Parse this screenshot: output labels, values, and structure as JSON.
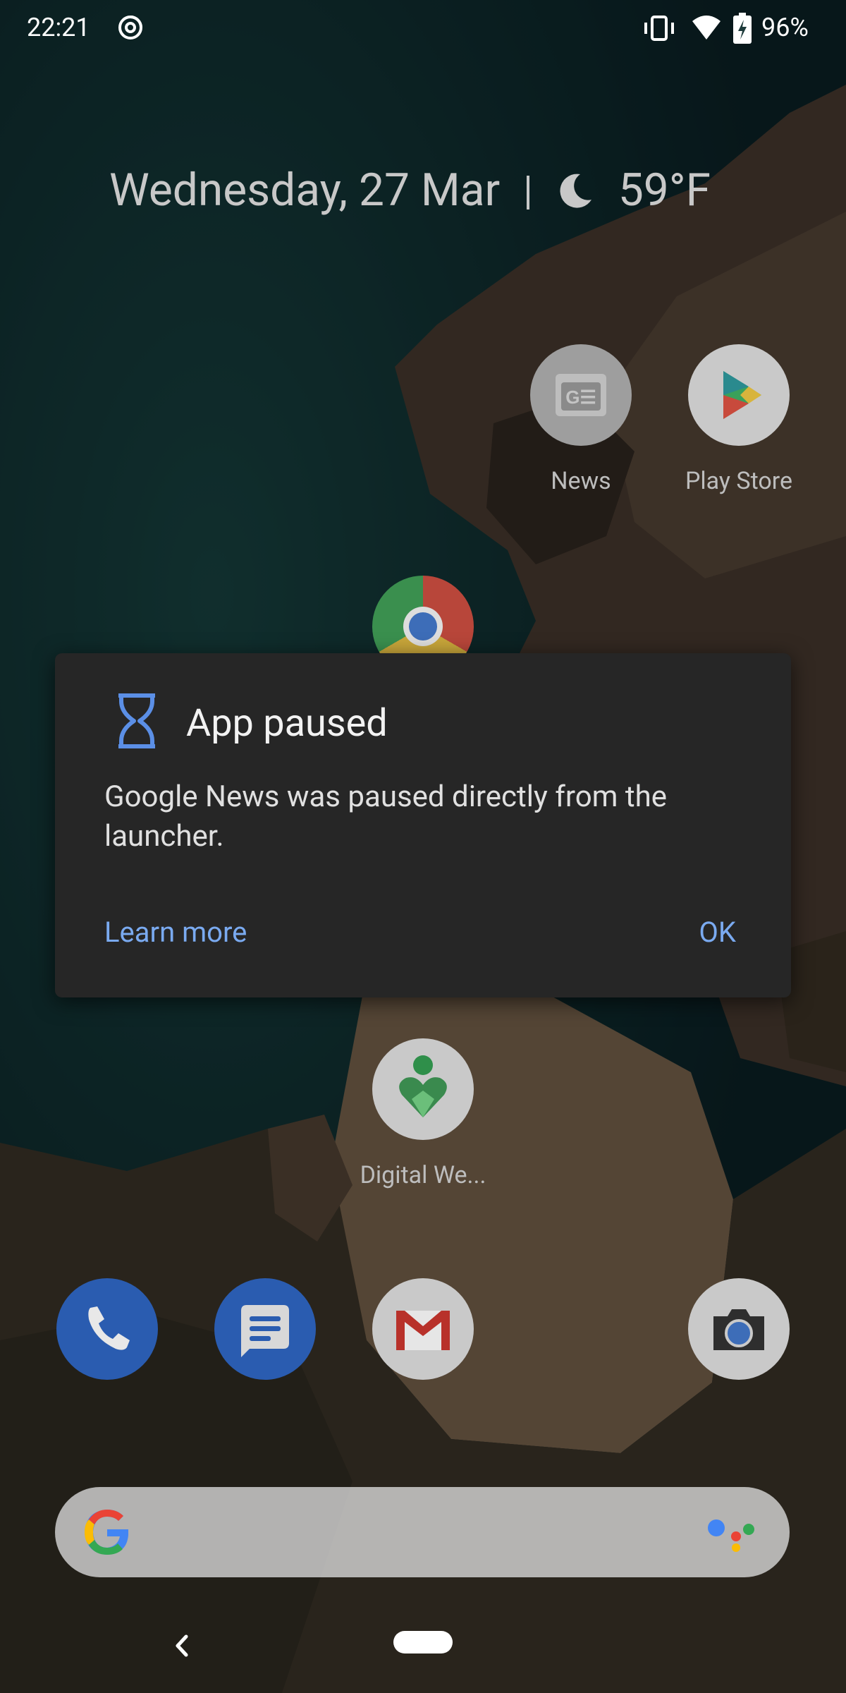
{
  "status_bar": {
    "time": "22:21",
    "battery_percent": "96%"
  },
  "at_a_glance": {
    "date": "Wednesday, 27 Mar",
    "temperature": "59°F"
  },
  "home_apps": {
    "news_label": "News",
    "play_store_label": "Play Store",
    "digital_wellbeing_label": "Digital We..."
  },
  "dialog": {
    "title": "App paused",
    "message": "Google News was paused directly from the launcher.",
    "learn_more": "Learn more",
    "ok": "OK"
  },
  "colors": {
    "accent_link": "#7aaaf0",
    "dialog_bg": "#262626",
    "hourglass": "#5b8fe6"
  },
  "icons": [
    "dnd-icon",
    "vibrate-icon",
    "wifi-icon",
    "battery-icon",
    "moon-icon",
    "hourglass-icon",
    "google-g-icon",
    "assistant-icon",
    "back-icon",
    "phone-icon",
    "messages-icon",
    "gmail-icon",
    "camera-icon",
    "chrome-icon",
    "play-store-icon",
    "news-icon",
    "digital-wellbeing-icon"
  ]
}
